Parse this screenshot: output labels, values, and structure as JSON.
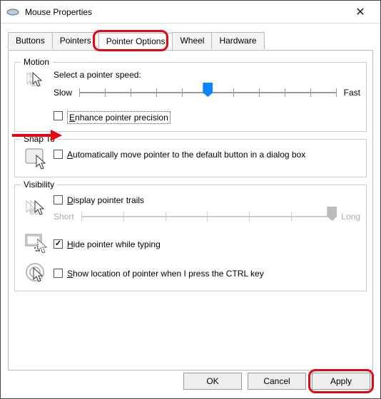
{
  "window": {
    "title": "Mouse Properties"
  },
  "tabs": [
    "Buttons",
    "Pointers",
    "Pointer Options",
    "Wheel",
    "Hardware"
  ],
  "active_tab": 2,
  "motion": {
    "legend": "Motion",
    "speed_label": "Select a pointer speed:",
    "slow": "Slow",
    "fast": "Fast",
    "enhance_label": "Enhance pointer precision",
    "enhance_checked": false
  },
  "snap": {
    "legend": "Snap To",
    "auto_label": "Automatically move pointer to the default button in a dialog box",
    "auto_checked": false
  },
  "visibility": {
    "legend": "Visibility",
    "trails_label": "Display pointer trails",
    "trails_checked": false,
    "short": "Short",
    "long": "Long",
    "hide_label": "Hide pointer while typing",
    "hide_checked": true,
    "ctrl_label": "Show location of pointer when I press the CTRL key",
    "ctrl_checked": false
  },
  "buttons": {
    "ok": "OK",
    "cancel": "Cancel",
    "apply": "Apply"
  }
}
